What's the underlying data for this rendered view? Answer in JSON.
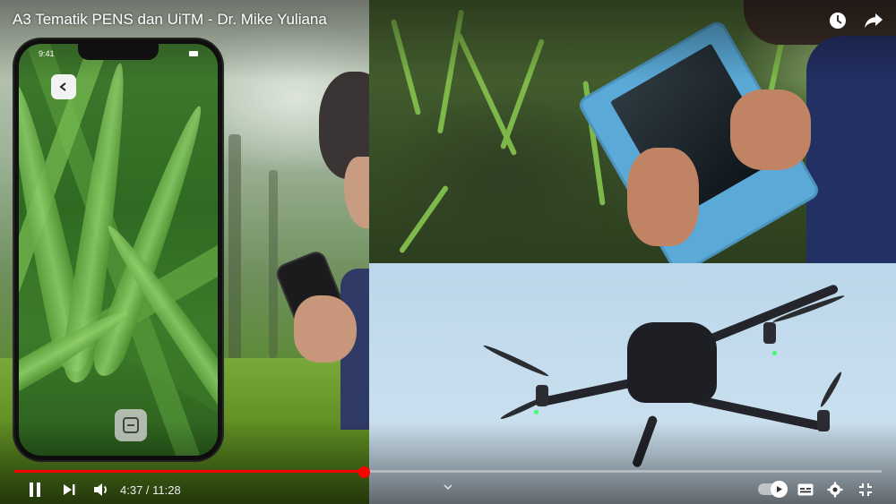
{
  "player": {
    "title": "A3 Tematik PENS dan UiTM - Dr. Mike Yuliana",
    "current_time": "4:37",
    "duration": "11:28",
    "time_separator": " / ",
    "progress_fraction": 0.403,
    "accent_color": "#ff0000"
  },
  "phone": {
    "status_time": "9:41"
  },
  "controls": {
    "top_right": [
      "clock-icon",
      "share-icon"
    ],
    "left": [
      "pause-icon",
      "next-icon",
      "volume-icon"
    ],
    "right": [
      "autoplay-toggle",
      "subtitles-icon",
      "gear-icon",
      "exit-fullscreen-icon"
    ],
    "center": [
      "chevron-down-icon"
    ]
  }
}
